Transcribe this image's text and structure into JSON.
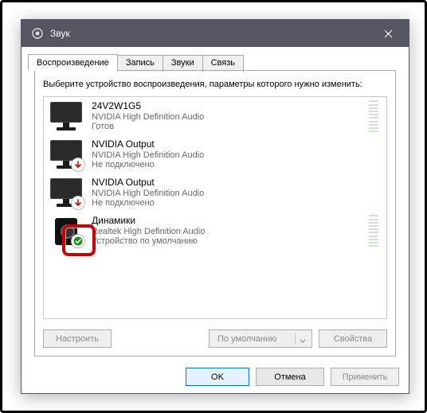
{
  "window": {
    "title": "Звук"
  },
  "tabs": [
    {
      "label": "Воспроизведение",
      "active": true
    },
    {
      "label": "Запись"
    },
    {
      "label": "Звуки"
    },
    {
      "label": "Связь"
    }
  ],
  "hint": "Выберите устройство воспроизведения, параметры которого нужно изменить:",
  "devices": [
    {
      "name": "24V2W1G5",
      "driver": "NVIDIA High Definition Audio",
      "status": "Готов",
      "icon": "monitor",
      "badge": "none",
      "meter": "faint"
    },
    {
      "name": "NVIDIA Output",
      "driver": "NVIDIA High Definition Audio",
      "status": "Не подключено",
      "icon": "monitor",
      "badge": "down",
      "meter": "none"
    },
    {
      "name": "NVIDIA Output",
      "driver": "NVIDIA High Definition Audio",
      "status": "Не подключено",
      "icon": "monitor",
      "badge": "down",
      "meter": "none"
    },
    {
      "name": "Динамики",
      "driver": "Realtek High Definition Audio",
      "status": "Устройство по умолчанию",
      "icon": "speaker",
      "badge": "check",
      "meter": "faint"
    }
  ],
  "panelButtons": {
    "configure": "Настроить",
    "default": "По умолчанию",
    "properties": "Свойства"
  },
  "dialogButtons": {
    "ok": "OK",
    "cancel": "Отмена",
    "apply": "Применить"
  }
}
